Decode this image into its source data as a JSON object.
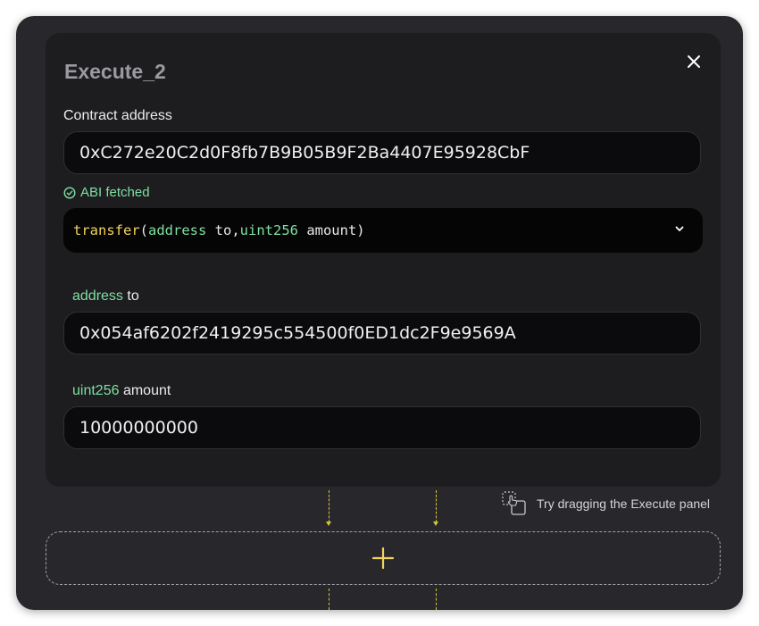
{
  "panel": {
    "title": "Execute_2",
    "close_icon": "close-icon"
  },
  "contract": {
    "label": "Contract address",
    "value": "0xC272e20C2d0F8fb7B9B05B9F2Ba4407E95928CbF",
    "abi_status": "ABI fetched",
    "abi_status_icon": "check-circle-icon"
  },
  "function_select": {
    "name": "transfer",
    "open_paren": "(",
    "param1_type": "address",
    "param1_name": " to,",
    "param2_type": "uint256",
    "param2_name": " amount)",
    "chevron_icon": "chevron-down-icon"
  },
  "params": [
    {
      "type": "address",
      "name": "to",
      "value": "0x054af6202f2419295c554500f0ED1dc2F9e9569A"
    },
    {
      "type": "uint256",
      "name": "amount",
      "value": "10000000000"
    }
  ],
  "hint": {
    "text": "Try dragging the Execute panel",
    "icon": "drag-icon"
  },
  "add_block": {
    "icon": "plus-icon"
  },
  "colors": {
    "accent_yellow": "#f2d35c",
    "type_green": "#7ee0a0",
    "panel_bg": "#1d1d20",
    "outer_bg": "#28282c"
  }
}
